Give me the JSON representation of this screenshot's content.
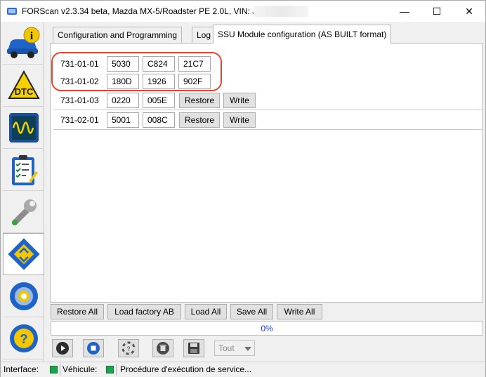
{
  "window": {
    "title": "FORScan v2.3.34 beta, Mazda MX-5/Roadster PE 2.0L, VIN: JMZ",
    "minimize_glyph": "—",
    "maximize_glyph": "☐",
    "close_glyph": "✕"
  },
  "sidebar": {
    "items": [
      {
        "icon": "car-info-icon"
      },
      {
        "icon": "dtc-icon"
      },
      {
        "icon": "oscilloscope-icon"
      },
      {
        "icon": "checklist-icon"
      },
      {
        "icon": "wrench-icon"
      },
      {
        "icon": "module-config-icon",
        "active": true
      },
      {
        "icon": "settings-gear-icon"
      },
      {
        "icon": "help-icon"
      }
    ]
  },
  "tabs": [
    {
      "label": "Configuration and Programming"
    },
    {
      "label": "Log"
    },
    {
      "label": "SSU Module configuration (AS BUILT format)",
      "active": true
    }
  ],
  "rows": [
    {
      "label": "731-01-01",
      "cells": [
        "5030",
        "C824",
        "21C7"
      ],
      "restore": "",
      "write": ""
    },
    {
      "label": "731-01-02",
      "cells": [
        "180D",
        "1926",
        "902F"
      ],
      "restore": "",
      "write": ""
    },
    {
      "label": "731-01-03",
      "cells": [
        "0220",
        "005E"
      ],
      "restore": "Restore",
      "write": "Write"
    },
    {
      "label": "731-02-01",
      "cells": [
        "5001",
        "008C"
      ],
      "restore": "Restore",
      "write": "Write"
    }
  ],
  "actions": {
    "restore_all": "Restore All",
    "load_factory": "Load factory AB",
    "load_all": "Load All",
    "save_all": "Save All",
    "write_all": "Write All"
  },
  "progress": {
    "percent": 0,
    "text": "0%"
  },
  "controls": {
    "icons": [
      "play-icon",
      "stop-icon",
      "lifebuoy-icon",
      "trash-icon",
      "save-disk-icon"
    ],
    "select_value": "Tout"
  },
  "status": {
    "interface_label": "Interface:",
    "vehicle_label": "Véhicule:",
    "message": "Procédure d'exécution de service..."
  },
  "colors": {
    "highlight": "#e8452c",
    "status_led": "#1aa34a",
    "progress_text": "#1a3fd0"
  }
}
